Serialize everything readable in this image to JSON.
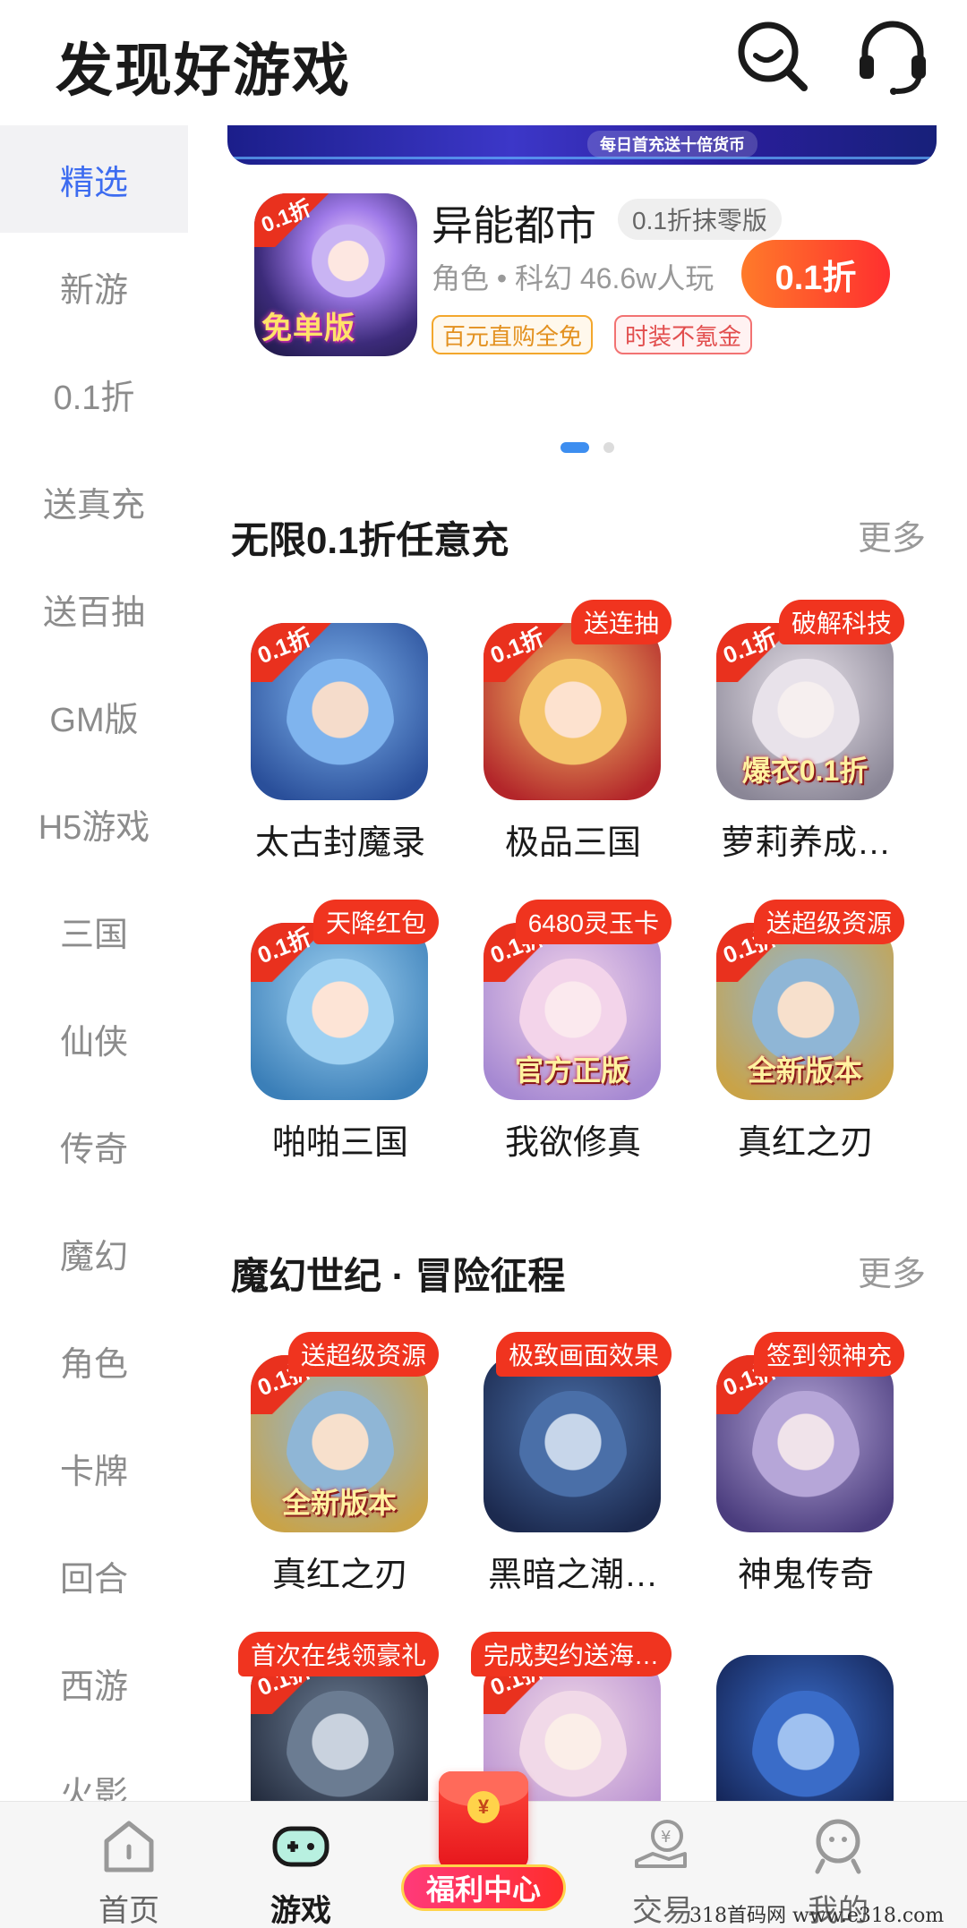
{
  "header": {
    "title": "发现好游戏",
    "search_icon": "search-icon",
    "support_icon": "headset-icon"
  },
  "sidebar": {
    "items": [
      {
        "label": "精选",
        "active": true
      },
      {
        "label": "新游"
      },
      {
        "label": "0.1折"
      },
      {
        "label": "送真充"
      },
      {
        "label": "送百抽"
      },
      {
        "label": "GM版"
      },
      {
        "label": "H5游戏"
      },
      {
        "label": "三国"
      },
      {
        "label": "仙侠"
      },
      {
        "label": "传奇"
      },
      {
        "label": "魔幻"
      },
      {
        "label": "角色"
      },
      {
        "label": "卡牌"
      },
      {
        "label": "回合"
      },
      {
        "label": "西游"
      },
      {
        "label": "火影"
      }
    ]
  },
  "banner": {
    "strip_text": "每日首充送十倍货币"
  },
  "featured": {
    "name": "异能都市",
    "tag": "0.1折抹零版",
    "meta": "角色 • 科幻  46.6w人玩",
    "button": "0.1折",
    "icon_caption": "免单版",
    "icon_corner": "0.1折",
    "badges": [
      "百元直购全免",
      "时装不氪金"
    ]
  },
  "carousel": {
    "pages": 2,
    "active": 1
  },
  "sections": [
    {
      "title": "无限0.1折任意充",
      "more": "更多",
      "games": [
        {
          "name": "太古封魔录",
          "badge": "",
          "corner": "0.1折",
          "caption": "",
          "palette": [
            "#7fb4ee",
            "#2a4f9a",
            "#f5dccb"
          ]
        },
        {
          "name": "极品三国",
          "badge": "送连抽",
          "corner": "0.1折",
          "caption": "",
          "palette": [
            "#f4c46a",
            "#b3262a",
            "#fde2cf"
          ]
        },
        {
          "name": "萝莉养成…",
          "badge": "破解科技",
          "corner": "0.1折",
          "caption": "爆衣0.1折",
          "palette": [
            "#e8e2ea",
            "#8a8696",
            "#f6efef"
          ]
        },
        {
          "name": "啪啪三国",
          "badge": "天降红包",
          "corner": "0.1折",
          "caption": "",
          "palette": [
            "#9fd1f2",
            "#3b7fb8",
            "#fde4d6"
          ]
        },
        {
          "name": "我欲修真",
          "badge": "6480灵玉卡",
          "corner": "0.1折",
          "caption": "官方正版",
          "palette": [
            "#f3d4ea",
            "#a689d2",
            "#fbe9ee"
          ]
        },
        {
          "name": "真红之刃",
          "badge": "送超级资源",
          "corner": "0.1折",
          "caption": "全新版本",
          "palette": [
            "#8fb6d6",
            "#c9a348",
            "#f7e0cc"
          ]
        }
      ]
    },
    {
      "title": "魔幻世纪 · 冒险征程",
      "more": "更多",
      "games": [
        {
          "name": "真红之刃",
          "badge": "送超级资源",
          "corner": "0.1折",
          "caption": "全新版本",
          "palette": [
            "#8fb6d6",
            "#c9a348",
            "#f7e0cc"
          ]
        },
        {
          "name": "黑暗之潮…",
          "badge": "极致画面效果",
          "corner": "",
          "caption": "",
          "palette": [
            "#4a6fa8",
            "#1c2a4f",
            "#c7d6ea"
          ]
        },
        {
          "name": "神鬼传奇",
          "badge": "签到领神充",
          "corner": "0.1折",
          "caption": "",
          "palette": [
            "#b6a6d8",
            "#4b3d7e",
            "#f0e3ea"
          ]
        },
        {
          "name": "",
          "badge": "首次在线领豪礼",
          "corner": "0.1折",
          "caption": "",
          "palette": [
            "#6b7c92",
            "#20283a",
            "#c9d2de"
          ]
        },
        {
          "name": "",
          "badge": "完成契约送海…",
          "corner": "0.1折",
          "caption": "",
          "palette": [
            "#f1d9e8",
            "#b78fd0",
            "#fbeee8"
          ]
        },
        {
          "name": "",
          "badge": "",
          "corner": "",
          "caption": "",
          "palette": [
            "#3a6cc8",
            "#142456",
            "#9fc1f0"
          ]
        }
      ]
    }
  ],
  "tabbar": {
    "tabs": [
      {
        "label": "首页",
        "icon": "home-icon"
      },
      {
        "label": "游戏",
        "icon": "gamepad-icon",
        "active": true
      },
      {
        "label": "福利中心",
        "icon": "red-envelope-icon"
      },
      {
        "label": "交易",
        "icon": "trade-icon"
      },
      {
        "label": "我的",
        "icon": "profile-icon"
      }
    ]
  },
  "watermark": "318首码网 www.e318.com",
  "colors": {
    "accent": "#3d6cf0",
    "badge_red": "#f0341f",
    "button_gradient": [
      "#ff7a2a",
      "#ff2f2f"
    ]
  }
}
